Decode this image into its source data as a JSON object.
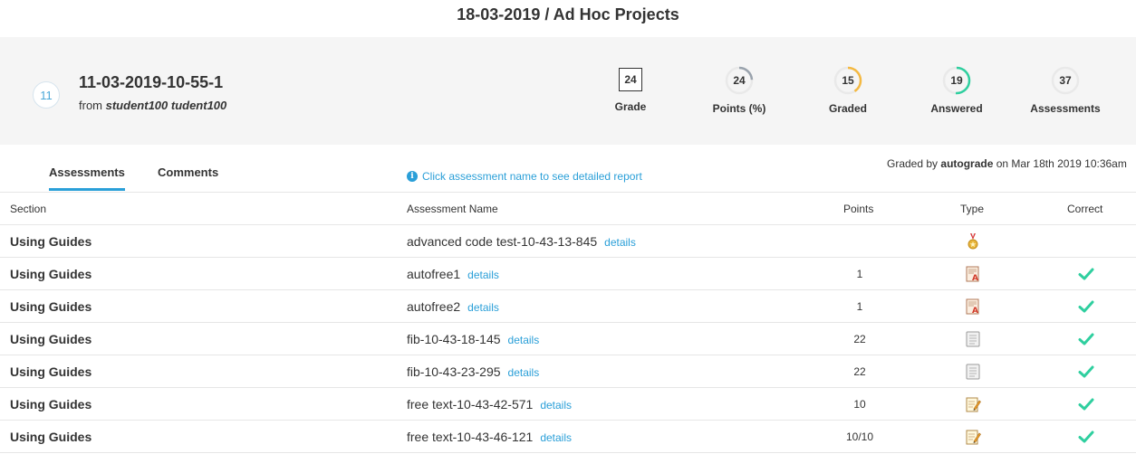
{
  "page_title": "18-03-2019 / Ad Hoc Projects",
  "attempt": {
    "number": "11",
    "name": "11-03-2019-10-55-1",
    "from_prefix": "from",
    "student": "student100 tudent100"
  },
  "stats": {
    "grade": {
      "value": "24",
      "label": "Grade"
    },
    "points": {
      "value": "24",
      "label": "Points (%)",
      "percent": 24,
      "color": "#9aa3ad"
    },
    "graded": {
      "value": "15",
      "label": "Graded",
      "fraction": 0.41,
      "color": "#f4b942"
    },
    "answered": {
      "value": "19",
      "label": "Answered",
      "fraction": 0.51,
      "color": "#2fcf9f"
    },
    "assessments": {
      "value": "37",
      "label": "Assessments",
      "fraction": 0,
      "color": "#9aa3ad"
    }
  },
  "tabs": [
    {
      "label": "Assessments",
      "active": true
    },
    {
      "label": "Comments",
      "active": false
    }
  ],
  "hint": "Click assessment name to see detailed report",
  "graded_by": {
    "prefix": "Graded by",
    "grader": "autograde",
    "suffix": "on Mar 18th 2019 10:36am"
  },
  "table": {
    "headers": {
      "section": "Section",
      "name": "Assessment Name",
      "points": "Points",
      "type": "Type",
      "correct": "Correct"
    },
    "details_label": "details",
    "rows": [
      {
        "section": "Using Guides",
        "name": "advanced code test-10-43-13-845",
        "points": "",
        "type": "medal-icon",
        "correct": false
      },
      {
        "section": "Using Guides",
        "name": "autofree1",
        "points": "1",
        "type": "autograded-doc-icon",
        "correct": true
      },
      {
        "section": "Using Guides",
        "name": "autofree2",
        "points": "1",
        "type": "autograded-doc-icon",
        "correct": true
      },
      {
        "section": "Using Guides",
        "name": "fib-10-43-18-145",
        "points": "22",
        "type": "scroll-doc-icon",
        "correct": true
      },
      {
        "section": "Using Guides",
        "name": "fib-10-43-23-295",
        "points": "22",
        "type": "scroll-doc-icon",
        "correct": true
      },
      {
        "section": "Using Guides",
        "name": "free text-10-43-42-571",
        "points": "10",
        "type": "pencil-doc-icon",
        "correct": true
      },
      {
        "section": "Using Guides",
        "name": "free text-10-43-46-121",
        "points": "10/10",
        "type": "pencil-doc-icon",
        "correct": true
      }
    ]
  },
  "colors": {
    "accent": "#2a9fd8",
    "check": "#2fcf9f",
    "panel": "#f5f5f5"
  }
}
